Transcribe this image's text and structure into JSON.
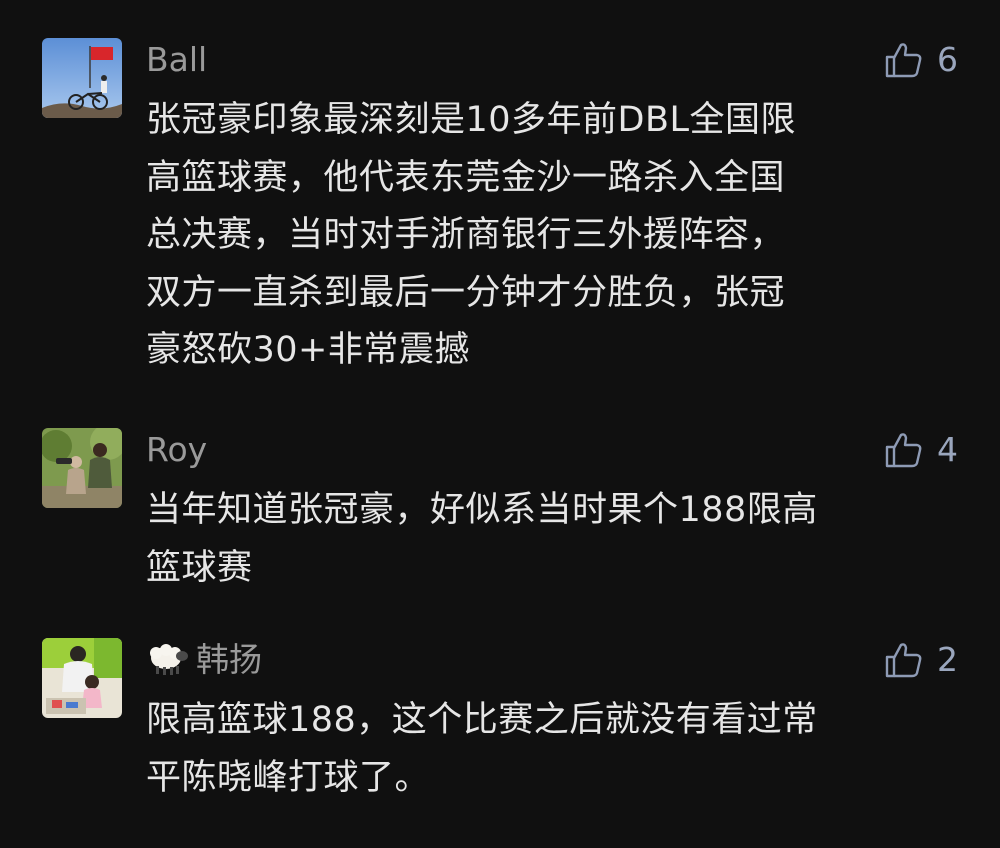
{
  "comments": [
    {
      "username": "Ball",
      "likes": "6",
      "avatar_icon": "avatar-cyclist-with-flag",
      "text_lines": [
        "张冠豪印象最深刻是10多年前DBL全国限",
        "高篮球赛，他代表东莞金沙一路杀入全国",
        "总决赛，当时对手浙商银行三外援阵容，",
        "双方一直杀到最后一分钟才分胜负，张冠",
        "豪怒砍30+非常震撼"
      ]
    },
    {
      "username": "Roy",
      "likes": "4",
      "avatar_icon": "avatar-outdoor-people",
      "text_lines": [
        "当年知道张冠豪，好似系当时果个188限高",
        "篮球赛"
      ]
    },
    {
      "username": "韩扬",
      "username_prefix_icon": "sheep-emoji",
      "likes": "2",
      "avatar_icon": "avatar-father-and-child",
      "text_lines": [
        "限高篮球188，这个比赛之后就没有看过常",
        "平陈晓峰打球了。"
      ]
    }
  ],
  "colors": {
    "background": "#101010",
    "username": "#9a9a9a",
    "text": "#e6e6e6",
    "like": "#9aa6bd"
  }
}
